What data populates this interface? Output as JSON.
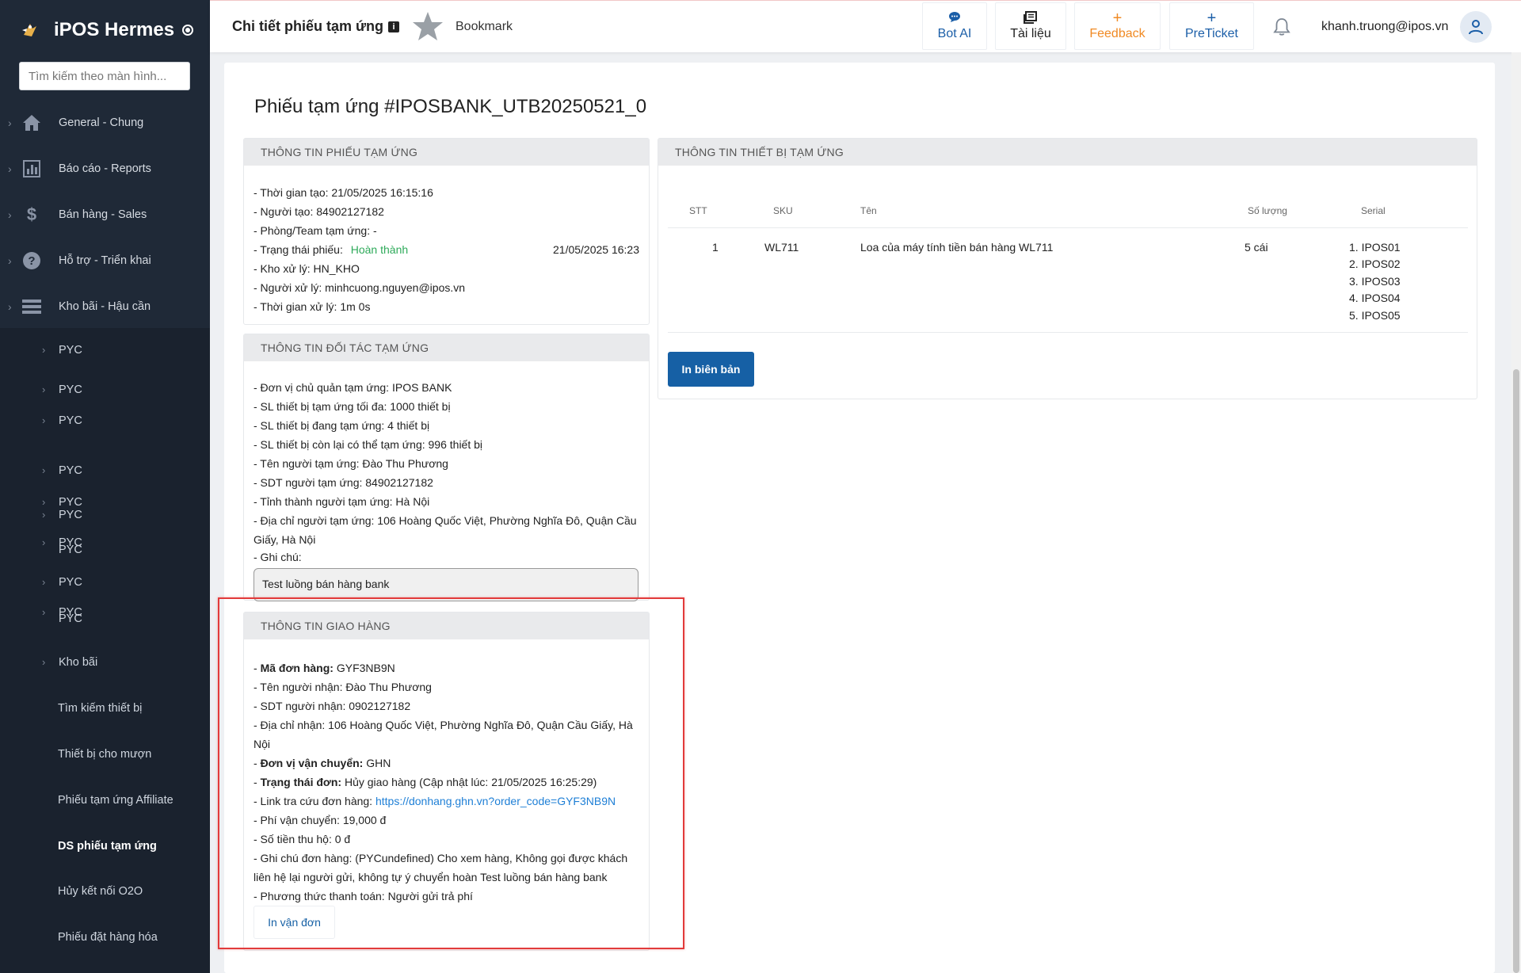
{
  "app": {
    "brand": "iPOS Hermes",
    "search_placeholder": "Tìm kiếm theo màn hình..."
  },
  "sidebar": {
    "top_items": [
      {
        "label": "General - Chung",
        "icon": "home-icon"
      },
      {
        "label": "Báo cáo - Reports",
        "icon": "chart-icon"
      },
      {
        "label": "Bán hàng - Sales",
        "icon": "dollar-icon"
      },
      {
        "label": "Hỗ trợ - Triển khai",
        "icon": "help-icon"
      },
      {
        "label": "Kho bãi - Hậu cần",
        "icon": "list-icon"
      }
    ],
    "sub_items": [
      {
        "label": "PYC"
      },
      {
        "label": "PYC"
      },
      {
        "label": "PYC"
      },
      {
        "label": "PYC"
      },
      {
        "label": "PYC"
      },
      {
        "label": "PYC"
      },
      {
        "label": "PYC"
      },
      {
        "label": "PYC"
      },
      {
        "label": "PYC"
      },
      {
        "label": "PYC"
      },
      {
        "label": "PYC"
      },
      {
        "label": "Kho bãi"
      },
      {
        "label": "Tìm kiếm thiết bị"
      },
      {
        "label": "Thiết bị cho mượn"
      },
      {
        "label": "Phiếu tạm ứng Affiliate"
      },
      {
        "label": "DS phiếu tạm ứng"
      },
      {
        "label": "Hủy kết nối O2O"
      },
      {
        "label": "Phiếu đặt hàng hóa"
      }
    ]
  },
  "header": {
    "page_title": "Chi tiết phiếu tạm ứng",
    "bookmark": "Bookmark",
    "buttons": {
      "bot": "Bot AI",
      "docs": "Tài liệu",
      "feedback": "Feedback",
      "preticket": "PreTicket"
    },
    "email": "khanh.truong@ipos.vn"
  },
  "document": {
    "title": "Phiếu tạm ứng #IPOSBANK_UTB20250521_0",
    "advance_info": {
      "heading": "THÔNG TIN PHIẾU TẠM ỨNG",
      "created_time": "- Thời gian tạo: 21/05/2025 16:15:16",
      "creator": "- Người tạo: 84902127182",
      "team": "- Phòng/Team tạm ứng: -",
      "status_label": "- Trạng thái phiếu:",
      "status_value": "Hoàn thành",
      "status_time": "21/05/2025 16:23",
      "warehouse": "- Kho xử lý: HN_KHO",
      "processor": "- Người xử lý: minhcuong.nguyen@ipos.vn",
      "process_time": "- Thời gian xử lý: 1m 0s"
    },
    "partner_info": {
      "heading": "THÔNG TIN ĐỐI TÁC TẠM ỨNG",
      "unit": "- Đơn vị chủ quản tạm ứng: IPOS BANK",
      "max_devices": "- SL thiết bị tạm ứng tối đa: 1000 thiết bị",
      "current_devices": "- SL thiết bị đang tạm ứng: 4 thiết bị",
      "remaining_devices": "- SL thiết bị còn lại có thể tạm ứng: 996 thiết bị",
      "name": "- Tên người tạm ứng: Đào Thu Phương",
      "phone": "- SDT người tạm ứng: 84902127182",
      "province": "- Tỉnh thành người tạm ứng: Hà Nội",
      "address": "- Địa chỉ người tạm ứng: 106 Hoàng Quốc Việt, Phường Nghĩa Đô, Quận Cầu Giấy, Hà Nội",
      "note_label": "- Ghi chú:",
      "note_value": "Test luồng bán hàng bank"
    },
    "delivery_info": {
      "heading": "THÔNG TIN GIAO HÀNG",
      "order_code_label": "Mã đơn hàng:",
      "order_code": "GYF3NB9N",
      "receiver": "- Tên người nhận: Đào Thu Phương",
      "receiver_phone": "- SDT người nhận: 0902127182",
      "address": "- Địa chỉ nhận: 106 Hoàng Quốc Việt, Phường Nghĩa Đô, Quận Cầu Giấy, Hà Nội",
      "carrier_label": "Đơn vị vận chuyển:",
      "carrier": "GHN",
      "status_label": "Trạng thái đơn:",
      "status": "Hủy giao hàng (Cập nhật lúc: 21/05/2025 16:25:29)",
      "tracking_label": "- Link tra cứu đơn hàng:",
      "tracking_url": "https://donhang.ghn.vn?order_code=GYF3NB9N",
      "shipping_fee": "- Phí vận chuyển: 19,000 đ",
      "cod": "- Số tiền thu hộ: 0 đ",
      "order_note": "- Ghi chú đơn hàng: (PYCundefined) Cho xem hàng, Không gọi được khách liên hệ lại người gửi, không tự ý chuyển hoàn Test luồng bán hàng bank",
      "payment": "- Phương thức thanh toán: Người gửi trả phí",
      "print_button": "In vận đơn"
    },
    "equipment_info": {
      "heading": "THÔNG TIN THIẾT BỊ TẠM ỨNG",
      "columns": {
        "stt": "STT",
        "sku": "SKU",
        "name": "Tên",
        "qty": "Số lượng",
        "serial": "Serial"
      },
      "rows": [
        {
          "stt": "1",
          "sku": "WL711",
          "name": "Loa của máy tính tiền bán hàng WL711",
          "qty": "5 cái",
          "serials": [
            "1. IPOS01",
            "2. IPOS02",
            "3. IPOS03",
            "4. IPOS04",
            "5. IPOS05"
          ]
        }
      ],
      "print_button": "In biên bản"
    }
  }
}
